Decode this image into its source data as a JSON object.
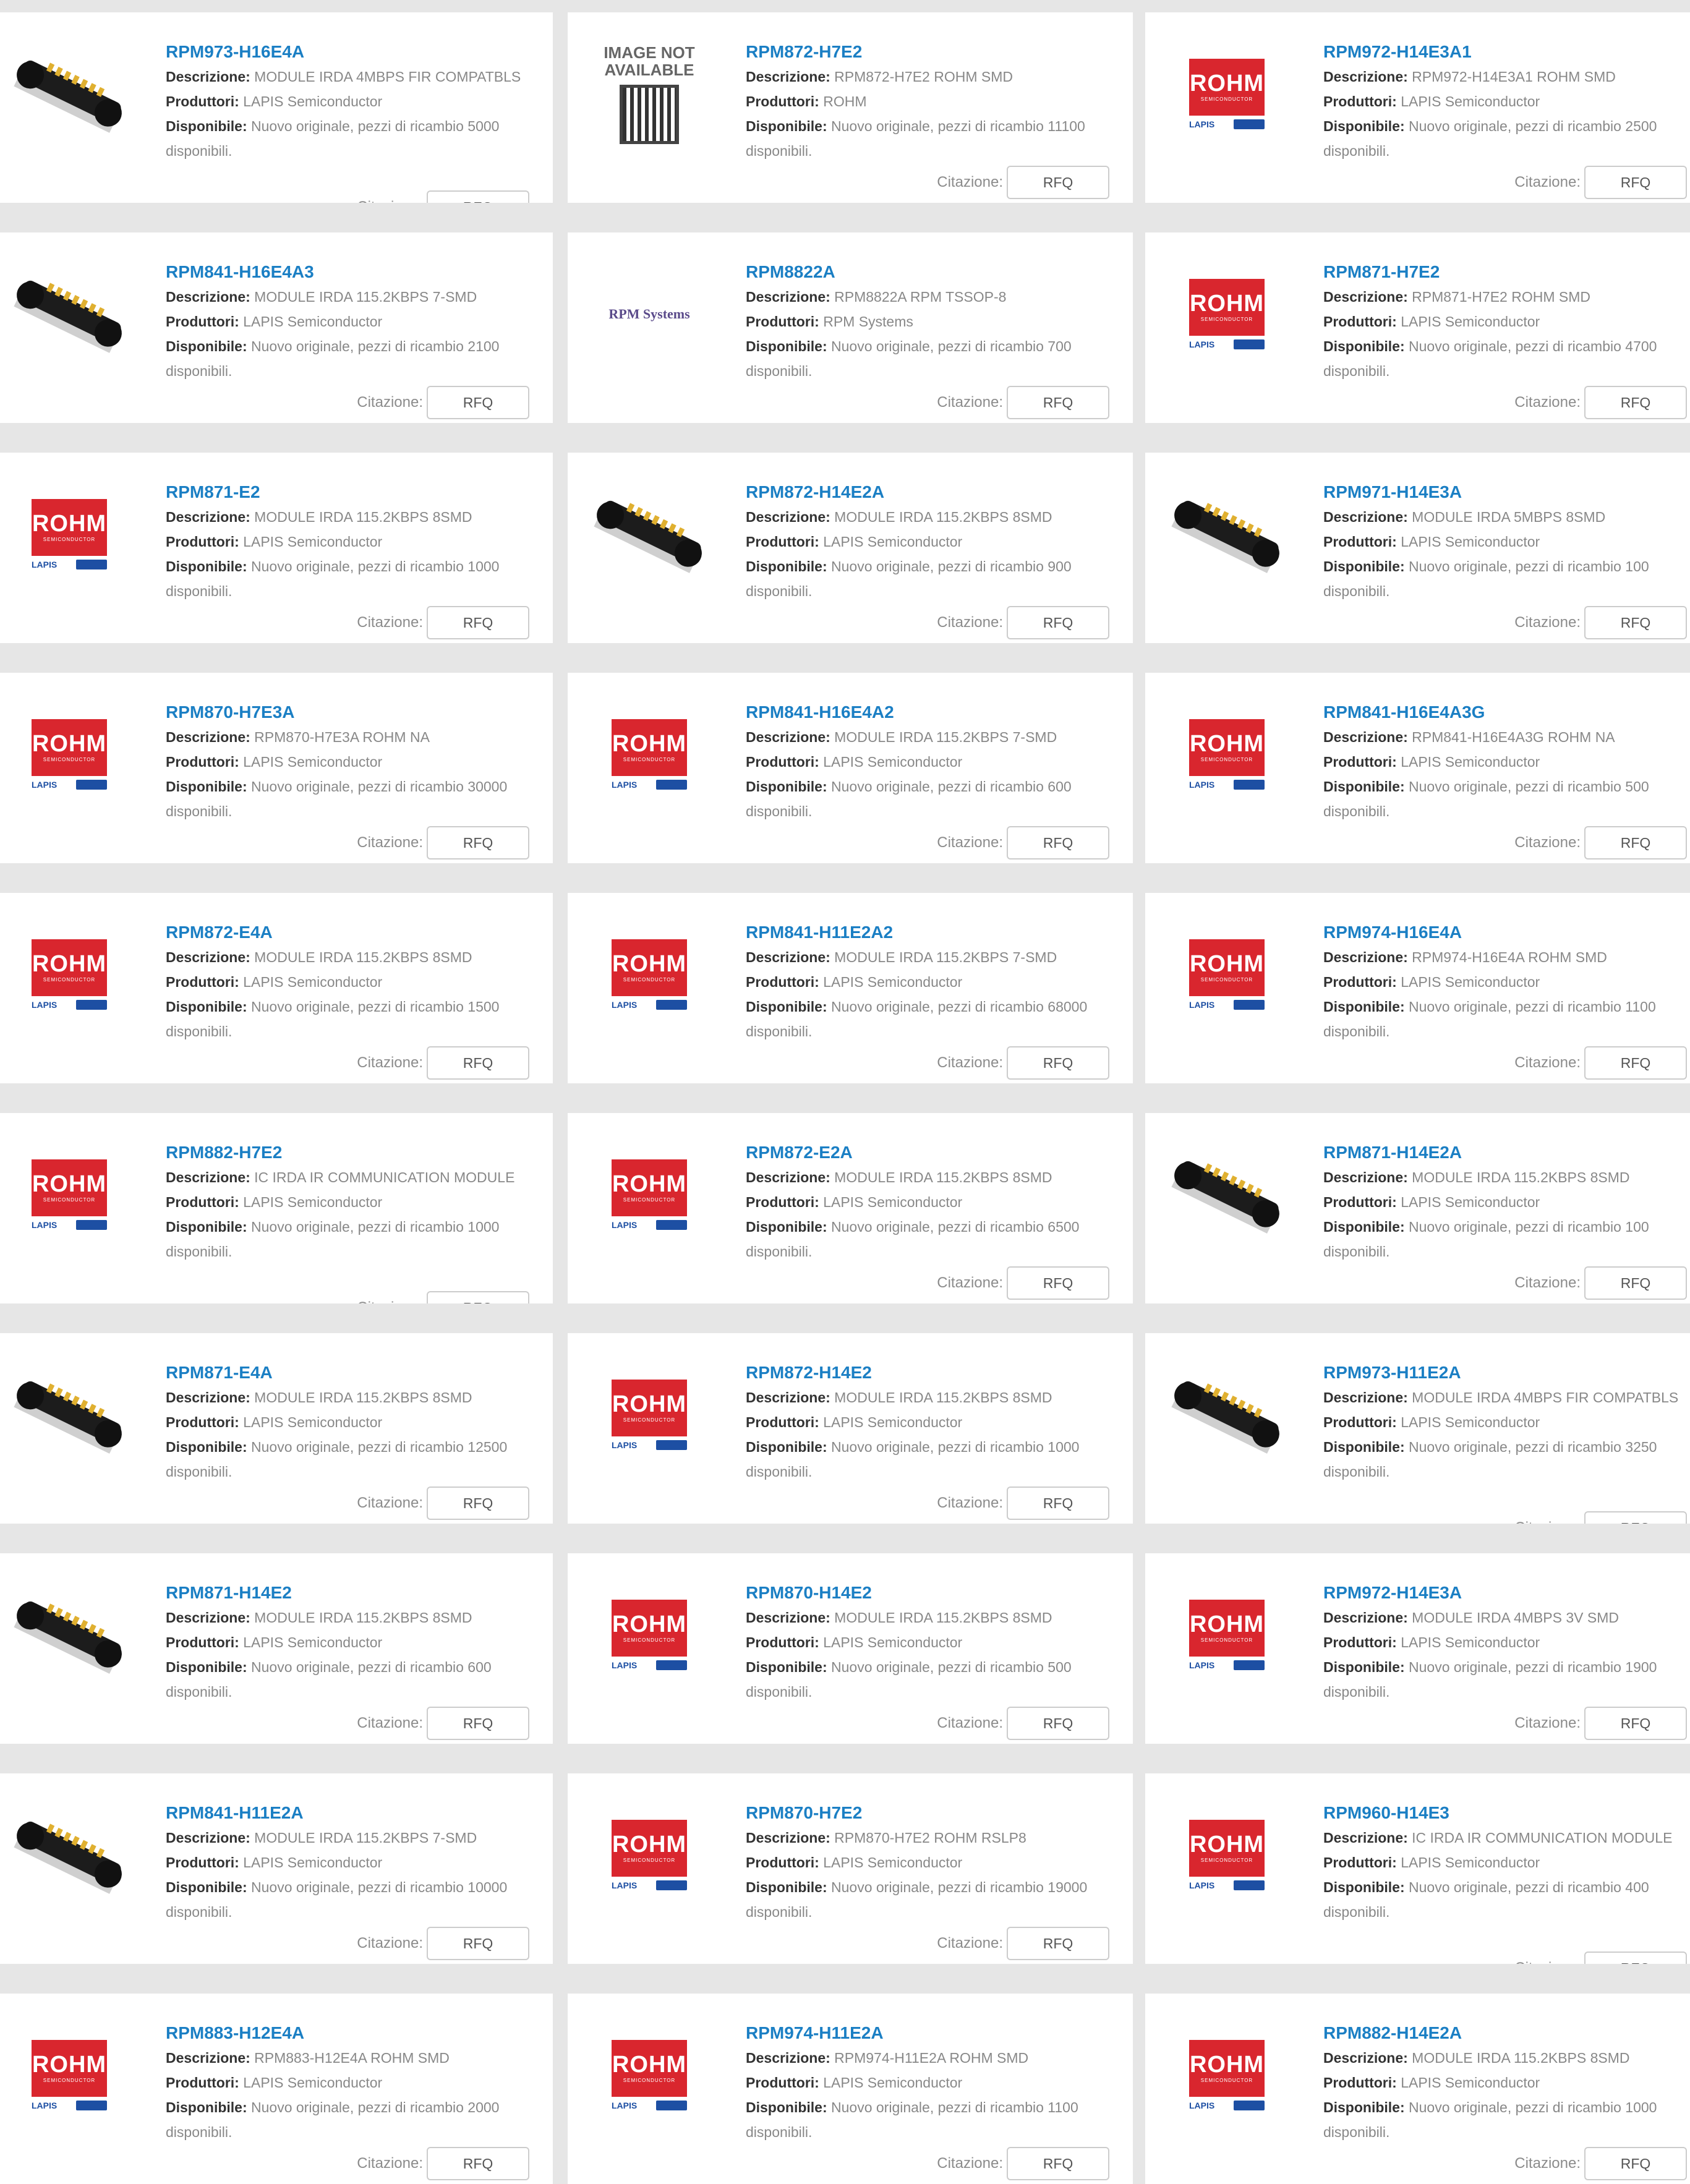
{
  "labels": {
    "description": "Descrizione:",
    "manufacturer": "Produttori:",
    "available": "Disponibile:",
    "quote": "Citazione:",
    "rfq": "RFQ",
    "available_suffix": "disponibili."
  },
  "logos": {
    "rohm_word": "ROHM",
    "rohm_sub": "SEMICONDUCTOR",
    "lapis_word": "LAPIS",
    "rpm_word": "RPM Systems",
    "na_text": "IMAGE NOT AVAILABLE"
  },
  "colors": {
    "link": "#1b7fc4",
    "rohm_red": "#d9262e",
    "page_bg": "#e6e6e6"
  },
  "products": [
    {
      "pn": "RPM973-H16E4A",
      "desc": "MODULE IRDA 4MBPS FIR COMPATBLS",
      "mfr": "LAPIS Semiconductor",
      "avail": "Nuovo originale, pezzi di ricambio 5000",
      "image": "module-black-image"
    },
    {
      "pn": "RPM872-H7E2",
      "desc": "RPM872-H7E2 ROHM SMD",
      "mfr": "ROHM",
      "avail": "Nuovo originale, pezzi di ricambio 11100",
      "image": "image-not-available"
    },
    {
      "pn": "RPM972-H14E3A1",
      "desc": "RPM972-H14E3A1 ROHM SMD",
      "mfr": "LAPIS Semiconductor",
      "avail": "Nuovo originale, pezzi di ricambio 2500",
      "image": "rohm-logo"
    },
    {
      "pn": "RPM841-H16E4A3",
      "desc": "MODULE IRDA 115.2KBPS 7-SMD",
      "mfr": "LAPIS Semiconductor",
      "avail": "Nuovo originale, pezzi di ricambio 2100",
      "image": "module-black-image"
    },
    {
      "pn": "RPM8822A",
      "desc": "RPM8822A RPM TSSOP-8",
      "mfr": "RPM Systems",
      "avail": "Nuovo originale, pezzi di ricambio 700",
      "image": "rpm-systems-logo"
    },
    {
      "pn": "RPM871-H7E2",
      "desc": "RPM871-H7E2 ROHM SMD",
      "mfr": "LAPIS Semiconductor",
      "avail": "Nuovo originale, pezzi di ricambio 4700",
      "image": "rohm-logo"
    },
    {
      "pn": "RPM871-E2",
      "desc": "MODULE IRDA 115.2KBPS 8SMD",
      "mfr": "LAPIS Semiconductor",
      "avail": "Nuovo originale, pezzi di ricambio 1000",
      "image": "rohm-logo"
    },
    {
      "pn": "RPM872-H14E2A",
      "desc": "MODULE IRDA 115.2KBPS 8SMD",
      "mfr": "LAPIS Semiconductor",
      "avail": "Nuovo originale, pezzi di ricambio 900",
      "image": "module-black-image"
    },
    {
      "pn": "RPM971-H14E3A",
      "desc": "MODULE IRDA 5MBPS 8SMD",
      "mfr": "LAPIS Semiconductor",
      "avail": "Nuovo originale, pezzi di ricambio 100",
      "image": "module-black-image"
    },
    {
      "pn": "RPM870-H7E3A",
      "desc": "RPM870-H7E3A ROHM NA",
      "mfr": "LAPIS Semiconductor",
      "avail": "Nuovo originale, pezzi di ricambio 30000",
      "image": "rohm-logo"
    },
    {
      "pn": "RPM841-H16E4A2",
      "desc": "MODULE IRDA 115.2KBPS 7-SMD",
      "mfr": "LAPIS Semiconductor",
      "avail": "Nuovo originale, pezzi di ricambio 600",
      "image": "rohm-logo"
    },
    {
      "pn": "RPM841-H16E4A3G",
      "desc": "RPM841-H16E4A3G ROHM NA",
      "mfr": "LAPIS Semiconductor",
      "avail": "Nuovo originale, pezzi di ricambio 500",
      "image": "rohm-logo"
    },
    {
      "pn": "RPM872-E4A",
      "desc": "MODULE IRDA 115.2KBPS 8SMD",
      "mfr": "LAPIS Semiconductor",
      "avail": "Nuovo originale, pezzi di ricambio 1500",
      "image": "rohm-logo"
    },
    {
      "pn": "RPM841-H11E2A2",
      "desc": "MODULE IRDA 115.2KBPS 7-SMD",
      "mfr": "LAPIS Semiconductor",
      "avail": "Nuovo originale, pezzi di ricambio 68000",
      "image": "rohm-logo"
    },
    {
      "pn": "RPM974-H16E4A",
      "desc": "RPM974-H16E4A ROHM SMD",
      "mfr": "LAPIS Semiconductor",
      "avail": "Nuovo originale, pezzi di ricambio 1100",
      "image": "rohm-logo"
    },
    {
      "pn": "RPM882-H7E2",
      "desc": "IC IRDA IR COMMUNICATION MODULE",
      "mfr": "LAPIS Semiconductor",
      "avail": "Nuovo originale, pezzi di ricambio 1000",
      "image": "rohm-logo"
    },
    {
      "pn": "RPM872-E2A",
      "desc": "MODULE IRDA 115.2KBPS 8SMD",
      "mfr": "LAPIS Semiconductor",
      "avail": "Nuovo originale, pezzi di ricambio 6500",
      "image": "rohm-logo"
    },
    {
      "pn": "RPM871-H14E2A",
      "desc": "MODULE IRDA 115.2KBPS 8SMD",
      "mfr": "LAPIS Semiconductor",
      "avail": "Nuovo originale, pezzi di ricambio 100",
      "image": "module-black-image"
    },
    {
      "pn": "RPM871-E4A",
      "desc": "MODULE IRDA 115.2KBPS 8SMD",
      "mfr": "LAPIS Semiconductor",
      "avail": "Nuovo originale, pezzi di ricambio 12500",
      "image": "module-black-image"
    },
    {
      "pn": "RPM872-H14E2",
      "desc": "MODULE IRDA 115.2KBPS 8SMD",
      "mfr": "LAPIS Semiconductor",
      "avail": "Nuovo originale, pezzi di ricambio 1000",
      "image": "rohm-logo"
    },
    {
      "pn": "RPM973-H11E2A",
      "desc": "MODULE IRDA 4MBPS FIR COMPATBLS",
      "mfr": "LAPIS Semiconductor",
      "avail": "Nuovo originale, pezzi di ricambio 3250",
      "image": "module-black-image"
    },
    {
      "pn": "RPM871-H14E2",
      "desc": "MODULE IRDA 115.2KBPS 8SMD",
      "mfr": "LAPIS Semiconductor",
      "avail": "Nuovo originale, pezzi di ricambio 600",
      "image": "module-black-image"
    },
    {
      "pn": "RPM870-H14E2",
      "desc": "MODULE IRDA 115.2KBPS 8SMD",
      "mfr": "LAPIS Semiconductor",
      "avail": "Nuovo originale, pezzi di ricambio 500",
      "image": "rohm-logo"
    },
    {
      "pn": "RPM972-H14E3A",
      "desc": "MODULE IRDA 4MBPS 3V SMD",
      "mfr": "LAPIS Semiconductor",
      "avail": "Nuovo originale, pezzi di ricambio 1900",
      "image": "rohm-logo"
    },
    {
      "pn": "RPM841-H11E2A",
      "desc": "MODULE IRDA 115.2KBPS 7-SMD",
      "mfr": "LAPIS Semiconductor",
      "avail": "Nuovo originale, pezzi di ricambio 10000",
      "image": "module-black-image"
    },
    {
      "pn": "RPM870-H7E2",
      "desc": "RPM870-H7E2 ROHM RSLP8",
      "mfr": "LAPIS Semiconductor",
      "avail": "Nuovo originale, pezzi di ricambio 19000",
      "image": "rohm-logo"
    },
    {
      "pn": "RPM960-H14E3",
      "desc": "IC IRDA IR COMMUNICATION MODULE",
      "mfr": "LAPIS Semiconductor",
      "avail": "Nuovo originale, pezzi di ricambio 400",
      "image": "rohm-logo"
    },
    {
      "pn": "RPM883-H12E4A",
      "desc": "RPM883-H12E4A ROHM SMD",
      "mfr": "LAPIS Semiconductor",
      "avail": "Nuovo originale, pezzi di ricambio 2000",
      "image": "rohm-logo"
    },
    {
      "pn": "RPM974-H11E2A",
      "desc": "RPM974-H11E2A ROHM SMD",
      "mfr": "LAPIS Semiconductor",
      "avail": "Nuovo originale, pezzi di ricambio 1100",
      "image": "rohm-logo"
    },
    {
      "pn": "RPM882-H14E2A",
      "desc": "MODULE IRDA 115.2KBPS 8SMD",
      "mfr": "LAPIS Semiconductor",
      "avail": "Nuovo originale, pezzi di ricambio 1000",
      "image": "rohm-logo"
    }
  ]
}
